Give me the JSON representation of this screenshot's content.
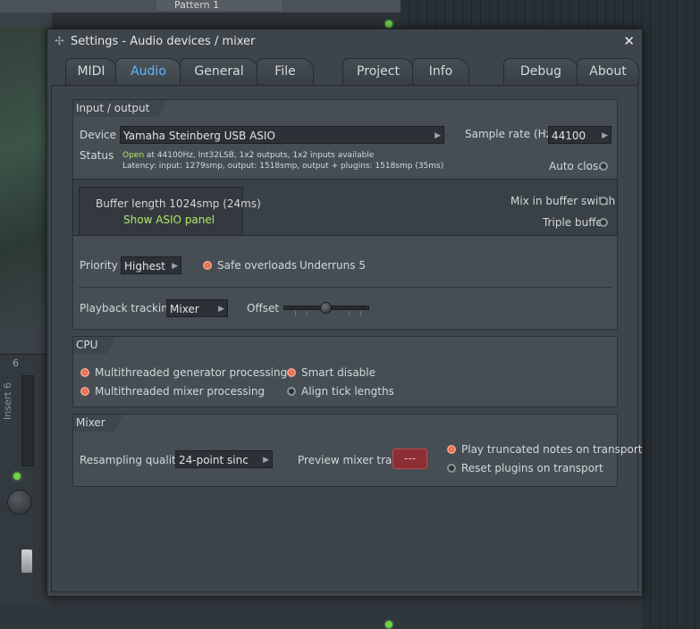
{
  "background": {
    "pattern_label": "Pattern 1",
    "mixer_track_number": "6",
    "mixer_insert_label": "Insert 6"
  },
  "window": {
    "title": "Settings - Audio devices / mixer",
    "close_icon": "close-icon"
  },
  "tabs": [
    {
      "label": "MIDI",
      "active": false
    },
    {
      "label": "Audio",
      "active": true
    },
    {
      "label": "General",
      "active": false
    },
    {
      "label": "File",
      "active": false
    },
    {
      "label": "Project",
      "active": false
    },
    {
      "label": "Info",
      "active": false
    },
    {
      "label": "Debug",
      "active": false
    },
    {
      "label": "About",
      "active": false
    }
  ],
  "io": {
    "section_title": "Input / output",
    "device_label": "Device",
    "device_value": "Yamaha Steinberg USB ASIO",
    "sample_rate_label": "Sample rate (Hz)",
    "sample_rate_value": "44100",
    "status_label": "Status",
    "status_open": "Open",
    "status_line1": "at 44100Hz, Int32LSB, 1x2 outputs, 1x2 inputs available",
    "status_line2": "Latency: input: 1279smp, output: 1518smp, output + plugins: 1518smp (35ms)",
    "auto_close_label": "Auto close",
    "auto_close_on": false,
    "buffer_length": "Buffer length 1024smp (24ms)",
    "show_asio_panel": "Show ASIO panel",
    "mix_in_buffer_switch_label": "Mix in buffer switch",
    "mix_in_buffer_switch_on": false,
    "triple_buffer_label": "Triple buffer",
    "triple_buffer_on": false,
    "priority_label": "Priority",
    "priority_value": "Highest",
    "safe_overloads_label": "Safe overloads",
    "safe_overloads_on": true,
    "underruns": "Underruns 5",
    "playback_tracking_label": "Playback tracking",
    "playback_tracking_value": "Mixer",
    "offset_label": "Offset",
    "offset_position": 0.5
  },
  "cpu": {
    "section_title": "CPU",
    "multithreaded_generator_label": "Multithreaded generator processing",
    "multithreaded_generator_on": true,
    "multithreaded_mixer_label": "Multithreaded mixer processing",
    "multithreaded_mixer_on": true,
    "smart_disable_label": "Smart disable",
    "smart_disable_on": true,
    "align_tick_lengths_label": "Align tick lengths",
    "align_tick_lengths_on": false
  },
  "mixer": {
    "section_title": "Mixer",
    "resampling_quality_label": "Resampling quality",
    "resampling_quality_value": "24-point sinc",
    "preview_mixer_track_label": "Preview mixer track",
    "preview_mixer_track_value": "---",
    "play_truncated_notes_label": "Play truncated notes on transport",
    "play_truncated_notes_on": true,
    "reset_plugins_label": "Reset plugins on transport",
    "reset_plugins_on": false
  },
  "colors": {
    "accent_tab": "#5fb6ff",
    "status_green": "#b4e66b",
    "radio_on": "#e5583a",
    "preview_button": "#8b2f35"
  }
}
